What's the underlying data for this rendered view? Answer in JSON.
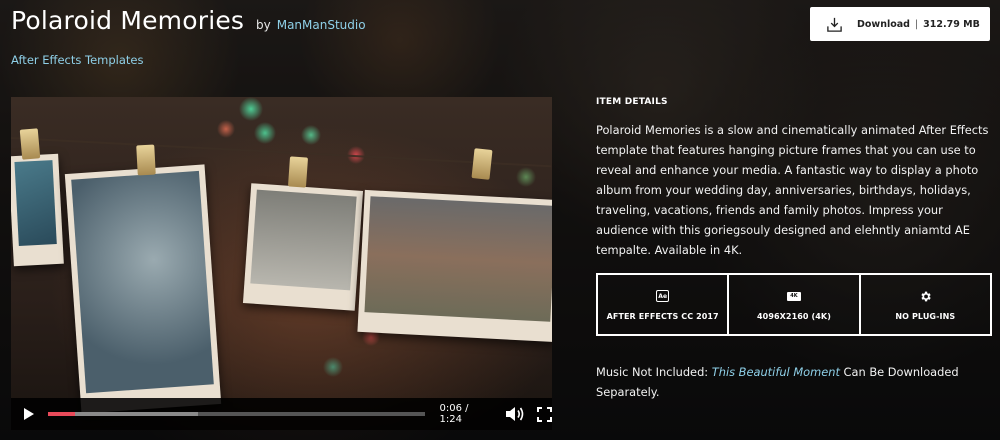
{
  "header": {
    "title": "Polaroid Memories",
    "by_label": "by",
    "author": "ManManStudio",
    "category": "After Effects Templates"
  },
  "download": {
    "label": "Download",
    "size": "312.79 MB"
  },
  "player": {
    "time": "0:06 / 1:24",
    "progress_played_fraction": 0.07,
    "progress_buffered_fraction": 0.39,
    "icons": {
      "play": "play-icon",
      "volume": "volume-icon",
      "fullscreen": "fullscreen-icon"
    }
  },
  "details": {
    "heading": "ITEM DETAILS",
    "description": "Polaroid Memories is a slow and cinematically animated After Effects template that features hanging picture frames that you can use to reveal and enhance your media. A fantastic way to display a photo album from your wedding day, anniversaries, birthdays, holidays, traveling, vacations, friends and family photos. Impress your audience with this goriegsouly designed and elehntly aniamtd AE tempalte. Available in 4K.",
    "features": [
      {
        "icon": "after-effects-icon",
        "icon_text": "Ae",
        "label": "AFTER EFFECTS CC 2017"
      },
      {
        "icon": "4k-icon",
        "icon_text": "4K",
        "label": "4096X2160 (4K)"
      },
      {
        "icon": "gear-icon",
        "label": "NO PLUG-INS"
      }
    ]
  },
  "music": {
    "prefix": "Music Not Included:",
    "song": "This Beautiful Moment",
    "suffix": "Can Be Downloaded Separately."
  },
  "colors": {
    "link": "#8fd0e8",
    "progress_played": "#e94a5a",
    "button_bg": "#ffffff"
  }
}
